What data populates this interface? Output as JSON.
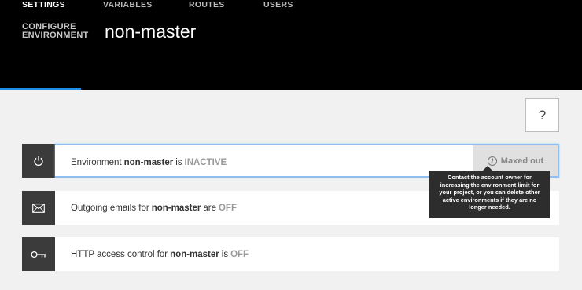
{
  "header": {
    "brand_line1": "CONFIGURE",
    "brand_line2": "ENVIRONMENT",
    "environment_name": "non-master"
  },
  "tabs": [
    {
      "label": "SETTINGS",
      "active": true
    },
    {
      "label": "VARIABLES",
      "active": false
    },
    {
      "label": "ROUTES",
      "active": false
    },
    {
      "label": "USERS",
      "active": false
    }
  ],
  "help_button": {
    "label": "?"
  },
  "settings": [
    {
      "icon": "power-icon",
      "prefix": "Environment",
      "env": "non-master",
      "verb": "is",
      "status": "INACTIVE",
      "action": "Maxed out"
    },
    {
      "icon": "envelope-icon",
      "prefix": "Outgoing emails for",
      "env": "non-master",
      "verb": "are",
      "status": "OFF"
    },
    {
      "icon": "key-icon",
      "prefix": "HTTP access control for",
      "env": "non-master",
      "verb": "is",
      "status": "OFF"
    }
  ],
  "tooltip": {
    "text": "Contact the account owner for increasing the environment limit for your project, or you can delete other active environments if they are no longer needed."
  },
  "colors": {
    "header_bg": "#000000",
    "active_tab_underline": "#1c8ee8",
    "icon_box_bg": "#3b3b3b",
    "page_bg": "#f1f1f1"
  }
}
